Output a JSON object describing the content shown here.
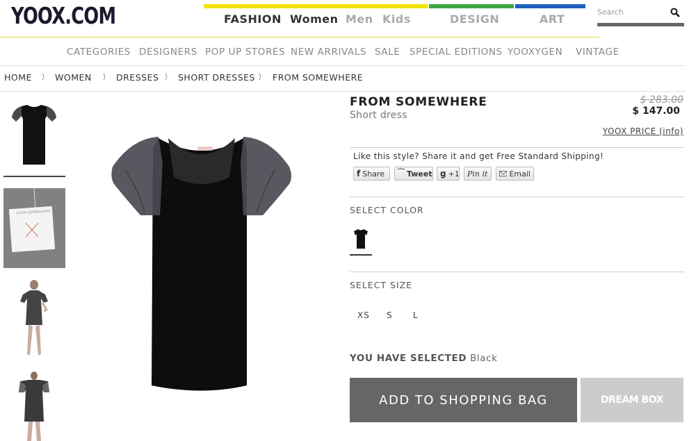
{
  "header": {
    "logo": "YOOX.COM",
    "search_placeholder": "Search",
    "colors": {
      "fashion": "#f2e400",
      "design": "#3fa846",
      "art": "#1f5fbf"
    },
    "topnav": {
      "fashion": "FASHION",
      "women": "Women",
      "men": "Men",
      "kids": "Kids",
      "design": "DESIGN",
      "art": "ART"
    }
  },
  "subnav": [
    "CATEGORIES",
    "DESIGNERS",
    "POP UP STORES",
    "NEW ARRIVALS",
    "SALE",
    "SPECIAL EDITIONS",
    "YOOXYGEN",
    "VINTAGE"
  ],
  "breadcrumb": [
    "HOME",
    "WOMEN",
    "DRESSES",
    "SHORT DRESSES",
    "FROM SOMEWHERE"
  ],
  "breadcrumb_sep": "⟩",
  "thumbnail_label": "FROM SOMEWHERE",
  "product": {
    "brand": "FROM SOMEWHERE",
    "type": "Short dress",
    "old_price": "$ 283.00",
    "new_price": "$ 147.00",
    "yoox_price_link": "YOOX PRICE (info)"
  },
  "share": {
    "text": "Like this style? Share it and get Free Standard Shipping!",
    "facebook": "Share",
    "twitter": "Tweet",
    "gplus": "+1",
    "pinterest": "Pin it",
    "email": "Email"
  },
  "select_color_label": "SELECT COLOR",
  "select_size_label": "SELECT SIZE",
  "sizes": [
    "XS",
    "S",
    "L"
  ],
  "selected": {
    "label": "YOU HAVE SELECTED",
    "value": "Black"
  },
  "buttons": {
    "bag": "ADD TO SHOPPING BAG",
    "dream": "DREAM BOX"
  }
}
